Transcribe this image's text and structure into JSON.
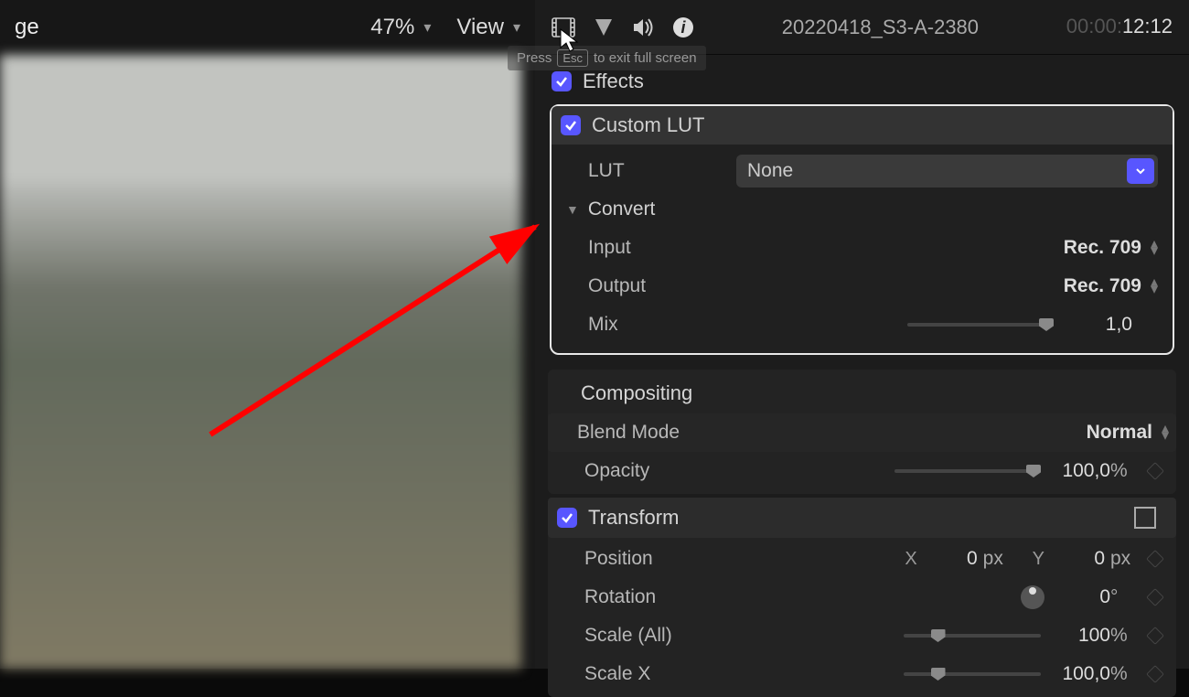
{
  "left": {
    "title_fragment": "ge",
    "zoom": "47%",
    "view_label": "View"
  },
  "header": {
    "clip_name": "20220418_S3-A-2380",
    "timecode_prefix": "00:00:",
    "timecode_active": "12:12",
    "esc_hint_pre": "Press",
    "esc_key": "Esc",
    "esc_hint_post": "to exit full screen"
  },
  "effects": {
    "title": "Effects",
    "custom_lut": {
      "title": "Custom LUT",
      "lut_label": "LUT",
      "lut_value": "None",
      "convert_label": "Convert",
      "input_label": "Input",
      "input_value": "Rec. 709",
      "output_label": "Output",
      "output_value": "Rec. 709",
      "mix_label": "Mix",
      "mix_value": "1,0"
    }
  },
  "compositing": {
    "title": "Compositing",
    "blend_label": "Blend Mode",
    "blend_value": "Normal",
    "opacity_label": "Opacity",
    "opacity_value": "100,0",
    "opacity_unit": "%"
  },
  "transform": {
    "title": "Transform",
    "position_label": "Position",
    "x_label": "X",
    "x_value": "0",
    "x_unit": "px",
    "y_label": "Y",
    "y_value": "0",
    "y_unit": "px",
    "rotation_label": "Rotation",
    "rotation_value": "0",
    "rotation_unit": "°",
    "scale_all_label": "Scale (All)",
    "scale_all_value": "100",
    "scale_all_unit": "%",
    "scale_x_label": "Scale X",
    "scale_x_value": "100,0",
    "scale_x_unit": "%"
  }
}
